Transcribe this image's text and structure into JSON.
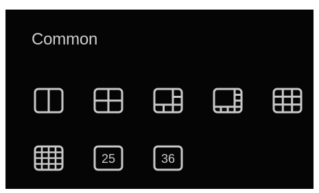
{
  "section": {
    "title": "Common"
  },
  "layouts": [
    {
      "icon": "split-2-icon"
    },
    {
      "icon": "grid-4-icon"
    },
    {
      "icon": "grid-6-icon"
    },
    {
      "icon": "grid-8-icon"
    },
    {
      "icon": "grid-9-icon"
    },
    {
      "icon": "grid-16-icon"
    },
    {
      "icon": "grid-25-icon",
      "label": "25"
    },
    {
      "icon": "grid-36-icon",
      "label": "36"
    }
  ],
  "colors": {
    "background": "#050505",
    "icon_stroke": "#c8c8c8",
    "text": "#cdcdcd"
  }
}
